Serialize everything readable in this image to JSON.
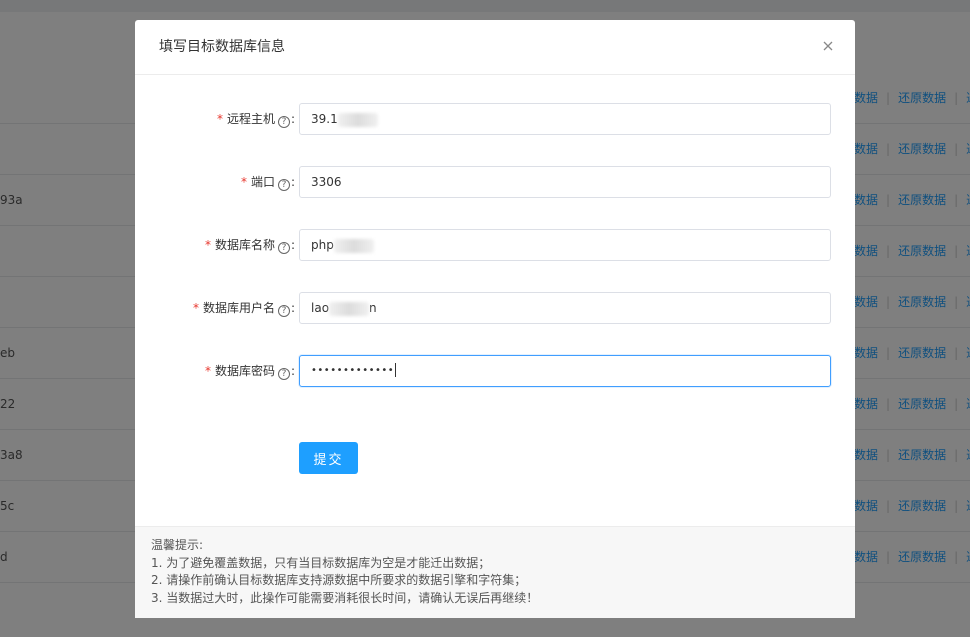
{
  "background": {
    "rows": [
      {
        "frag": "",
        "actions": [
          "数据",
          "还原数据",
          "迁"
        ]
      },
      {
        "frag": "",
        "actions": [
          "数据",
          "还原数据",
          "迁"
        ]
      },
      {
        "frag": "93a",
        "actions": [
          "数据",
          "还原数据",
          "迁"
        ]
      },
      {
        "frag": "",
        "actions": [
          "数据",
          "还原数据",
          "迁"
        ]
      },
      {
        "frag": "",
        "actions": [
          "数据",
          "还原数据",
          "迁"
        ]
      },
      {
        "frag": "eb",
        "actions": [
          "数据",
          "还原数据",
          "迁"
        ]
      },
      {
        "frag": "22",
        "actions": [
          "数据",
          "还原数据",
          "迁"
        ]
      },
      {
        "frag": "3a8",
        "actions": [
          "数据",
          "还原数据",
          "迁"
        ]
      },
      {
        "frag": "5c",
        "actions": [
          "数据",
          "还原数据",
          "迁"
        ]
      },
      {
        "frag": "d",
        "actions": [
          "数据",
          "还原数据",
          "迁"
        ]
      }
    ]
  },
  "dialog": {
    "title": "填写目标数据库信息",
    "fields": {
      "host": {
        "label": "远程主机",
        "value_prefix": "39.1",
        "value_suffix": ""
      },
      "port": {
        "label": "端口",
        "value_prefix": "3306",
        "value_suffix": ""
      },
      "db_name": {
        "label": "数据库名称",
        "value_prefix": "php",
        "value_suffix": ""
      },
      "db_user": {
        "label": "数据库用户名",
        "value_prefix": "lao",
        "value_suffix": "n"
      },
      "db_password": {
        "label": "数据库密码",
        "value_prefix": "•••••••••••••",
        "value_suffix": ""
      }
    },
    "submit_label": "提交",
    "tips": {
      "title": "温馨提示:",
      "lines": [
        "1. 为了避免覆盖数据，只有当目标数据库为空是才能迁出数据；",
        "2. 请操作前确认目标数据库支持源数据中所要求的数据引擎和字符集；",
        "3. 当数据过大时，此操作可能需要消耗很长时间，请确认无误后再继续！"
      ]
    }
  },
  "colors": {
    "accent": "#1e9fff",
    "required": "#e8362d",
    "link": "#20a0ff"
  }
}
